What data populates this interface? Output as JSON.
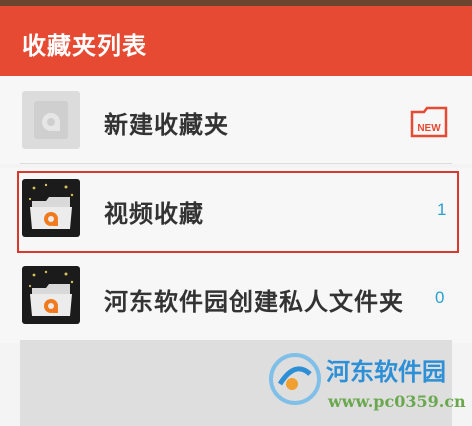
{
  "header": {
    "title": "收藏夹列表"
  },
  "items": [
    {
      "label": "新建收藏夹",
      "badge": "NEW"
    },
    {
      "label": "视频收藏",
      "count": "1"
    },
    {
      "label": "河东软件园创建私人文件夹",
      "count": "0"
    }
  ],
  "watermark": {
    "name": "河东软件园",
    "url": "www.pc0359.cn"
  },
  "colors": {
    "header": "#e64a32",
    "accent": "#2aa0d0",
    "selection": "#d9382c"
  }
}
